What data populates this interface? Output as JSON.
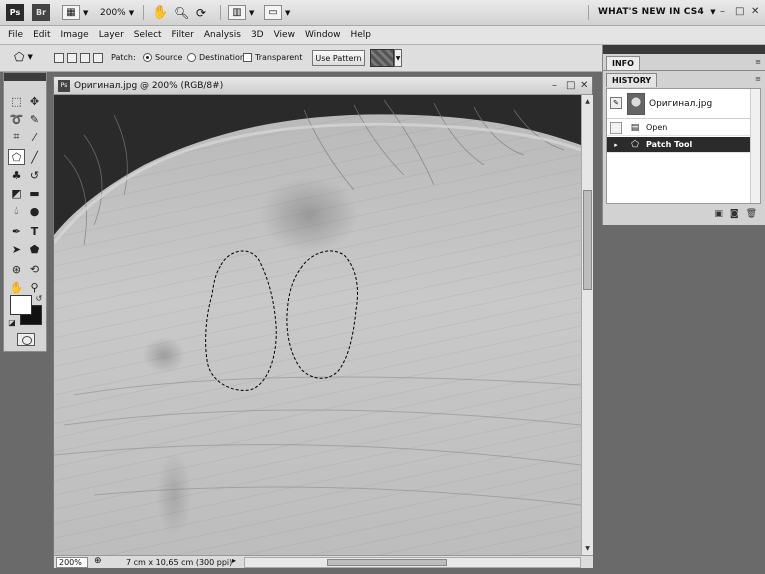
{
  "appbar": {
    "ps": "Ps",
    "br": "Br",
    "zoom": "200%",
    "workspace": "WHAT'S NEW IN CS4",
    "minimize": "–",
    "restore": "□",
    "close": "✕"
  },
  "menu": [
    "File",
    "Edit",
    "Image",
    "Layer",
    "Select",
    "Filter",
    "Analysis",
    "3D",
    "View",
    "Window",
    "Help"
  ],
  "options": {
    "patch_label": "Patch:",
    "source": "Source",
    "destination": "Destination",
    "transparent": "Transparent",
    "use_pattern": "Use Pattern"
  },
  "document": {
    "title": "Оригинал.jpg @ 200% (RGB/8#)",
    "zoom": "200%",
    "size": "7 cm x 10,65 cm (300 ppi)"
  },
  "panels": {
    "info_tab": "INFO",
    "history_tab": "HISTORY",
    "snapshot": "Оригинал.jpg",
    "history_items": [
      "Open",
      "Patch Tool"
    ]
  },
  "colors": {
    "selected_history": "#2b2b2b",
    "panel_dark": "#3a3a3a"
  }
}
